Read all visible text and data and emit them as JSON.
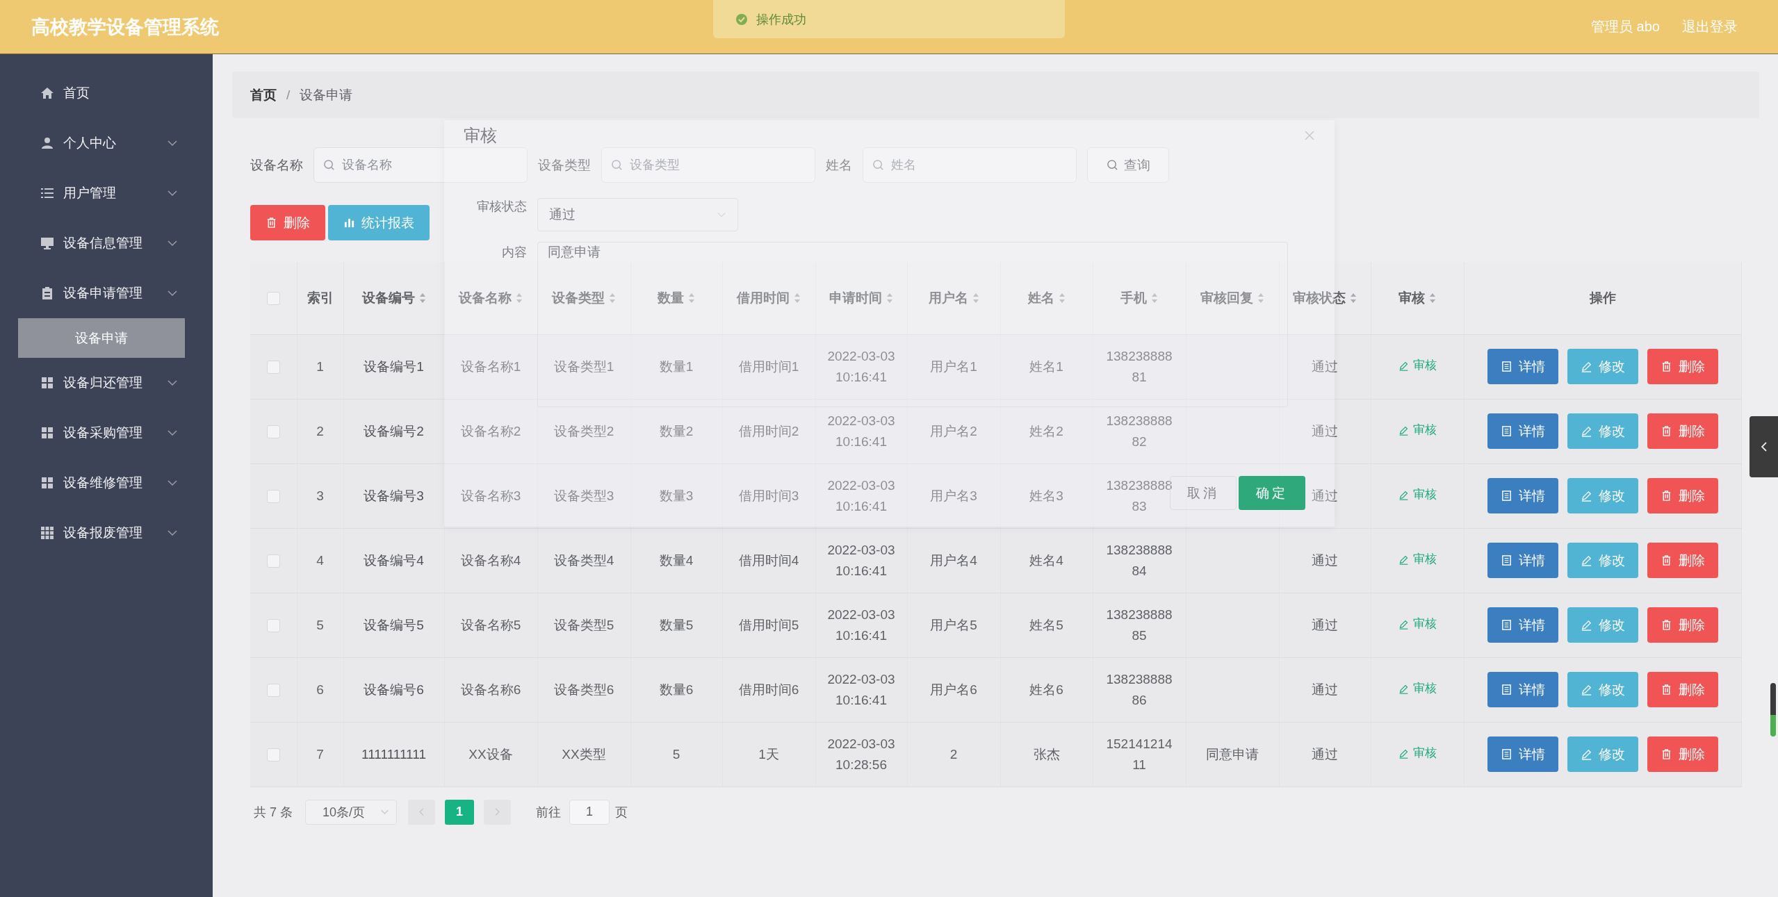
{
  "header": {
    "title": "高校教学设备管理系统",
    "user": "管理员 abo",
    "logout": "退出登录"
  },
  "toast": {
    "message": "操作成功"
  },
  "sidebar": {
    "items": [
      {
        "label": "首页",
        "kind": "link"
      },
      {
        "label": "个人中心",
        "kind": "submenu"
      },
      {
        "label": "用户管理",
        "kind": "submenu"
      },
      {
        "label": "设备信息管理",
        "kind": "submenu"
      },
      {
        "label": "设备申请管理",
        "kind": "submenu",
        "children": [
          {
            "label": "设备申请",
            "selected": true
          }
        ]
      },
      {
        "label": "设备归还管理",
        "kind": "submenu"
      },
      {
        "label": "设备采购管理",
        "kind": "submenu"
      },
      {
        "label": "设备维修管理",
        "kind": "submenu"
      },
      {
        "label": "设备报废管理",
        "kind": "submenu"
      }
    ]
  },
  "breadcrumb": {
    "items": [
      "首页",
      "设备申请"
    ],
    "separator": "/"
  },
  "search": {
    "fields": [
      {
        "label": "设备名称",
        "placeholder": "设备名称"
      },
      {
        "label": "设备类型",
        "placeholder": "设备类型"
      },
      {
        "label": "姓名",
        "placeholder": "姓名"
      }
    ],
    "button": "查询"
  },
  "toolbar": [
    {
      "label": "删除",
      "kind": "danger"
    },
    {
      "label": "统计报表",
      "kind": "info"
    }
  ],
  "table": {
    "select_all": {
      "checked": false
    },
    "columns": [
      {
        "label": "索引",
        "sortable": false
      },
      {
        "label": "设备编号",
        "sortable": true
      },
      {
        "label": "设备名称",
        "sortable": true
      },
      {
        "label": "设备类型",
        "sortable": true
      },
      {
        "label": "数量",
        "sortable": true
      },
      {
        "label": "借用时间",
        "sortable": true
      },
      {
        "label": "申请时间",
        "sortable": true
      },
      {
        "label": "用户名",
        "sortable": true
      },
      {
        "label": "姓名",
        "sortable": true
      },
      {
        "label": "手机",
        "sortable": true
      },
      {
        "label": "审核回复",
        "sortable": true
      },
      {
        "label": "审核状态",
        "sortable": true
      },
      {
        "label": "审核",
        "sortable": true
      },
      {
        "label": "操作",
        "sortable": false
      }
    ],
    "rows": [
      {
        "checked": false,
        "index": "1",
        "code": "设备编号1",
        "name": "设备名称1",
        "type": "设备类型1",
        "quantity": "数量1",
        "borrow_time": "借用时间1",
        "apply_time": "2022-03-03 10:16:41",
        "username": "用户名1",
        "real_name": "姓名1",
        "phone": "13823888881",
        "status": "通过",
        "review": "审核",
        "actions": [
          {
            "label": "详情",
            "kind": "primary"
          },
          {
            "label": "修改",
            "kind": "info"
          },
          {
            "label": "删除",
            "kind": "danger"
          }
        ]
      },
      {
        "checked": false,
        "index": "2",
        "code": "设备编号2",
        "name": "设备名称2",
        "type": "设备类型2",
        "quantity": "数量2",
        "borrow_time": "借用时间2",
        "apply_time": "2022-03-03 10:16:41",
        "username": "用户名2",
        "real_name": "姓名2",
        "phone": "13823888882",
        "status": "通过",
        "review": "审核",
        "actions": [
          {
            "label": "详情",
            "kind": "primary"
          },
          {
            "label": "修改",
            "kind": "info"
          },
          {
            "label": "删除",
            "kind": "danger"
          }
        ]
      },
      {
        "checked": false,
        "index": "3",
        "code": "设备编号3",
        "name": "设备名称3",
        "type": "设备类型3",
        "quantity": "数量3",
        "borrow_time": "借用时间3",
        "apply_time": "2022-03-03 10:16:41",
        "username": "用户名3",
        "real_name": "姓名3",
        "phone": "13823888883",
        "status": "通过",
        "review": "审核",
        "actions": [
          {
            "label": "详情",
            "kind": "primary"
          },
          {
            "label": "修改",
            "kind": "info"
          },
          {
            "label": "删除",
            "kind": "danger"
          }
        ]
      },
      {
        "checked": false,
        "index": "4",
        "code": "设备编号4",
        "name": "设备名称4",
        "type": "设备类型4",
        "quantity": "数量4",
        "borrow_time": "借用时间4",
        "apply_time": "2022-03-03 10:16:41",
        "username": "用户名4",
        "real_name": "姓名4",
        "phone": "13823888884",
        "status": "通过",
        "review": "审核",
        "actions": [
          {
            "label": "详情",
            "kind": "primary"
          },
          {
            "label": "修改",
            "kind": "info"
          },
          {
            "label": "删除",
            "kind": "danger"
          }
        ]
      },
      {
        "checked": false,
        "index": "5",
        "code": "设备编号5",
        "name": "设备名称5",
        "type": "设备类型5",
        "quantity": "数量5",
        "borrow_time": "借用时间5",
        "apply_time": "2022-03-03 10:16:41",
        "username": "用户名5",
        "real_name": "姓名5",
        "phone": "13823888885",
        "status": "通过",
        "review": "审核",
        "actions": [
          {
            "label": "详情",
            "kind": "primary"
          },
          {
            "label": "修改",
            "kind": "info"
          },
          {
            "label": "删除",
            "kind": "danger"
          }
        ]
      },
      {
        "checked": false,
        "index": "6",
        "code": "设备编号6",
        "name": "设备名称6",
        "type": "设备类型6",
        "quantity": "数量6",
        "borrow_time": "借用时间6",
        "apply_time": "2022-03-03 10:16:41",
        "username": "用户名6",
        "real_name": "姓名6",
        "phone": "13823888886",
        "status": "通过",
        "review": "审核",
        "actions": [
          {
            "label": "详情",
            "kind": "primary"
          },
          {
            "label": "修改",
            "kind": "info"
          },
          {
            "label": "删除",
            "kind": "danger"
          }
        ]
      },
      {
        "checked": false,
        "index": "7",
        "code": "1111111111",
        "name": "XX设备",
        "type": "XX类型",
        "quantity": "5",
        "borrow_time": "1天",
        "apply_time": "2022-03-03 10:28:56",
        "username": "2",
        "real_name": "张杰",
        "phone": "15214121411",
        "reply": "同意申请",
        "status": "通过",
        "review": "审核",
        "actions": [
          {
            "label": "详情",
            "kind": "primary"
          },
          {
            "label": "修改",
            "kind": "info"
          },
          {
            "label": "删除",
            "kind": "danger"
          }
        ]
      }
    ]
  },
  "pagination": {
    "total": "共 7 条",
    "page_size": "10条/页",
    "pages": [
      {
        "label": "1",
        "selected": true
      }
    ],
    "goto_label": "前往",
    "goto_value": "1",
    "goto_suffix": "页"
  },
  "dialog": {
    "title": "审核",
    "status_label": "审核状态",
    "status_value": "通过",
    "content_label": "内容",
    "content_value": "同意申请",
    "buttons": [
      {
        "label": "取消",
        "kind": "default"
      },
      {
        "label": "确定",
        "kind": "primary"
      }
    ]
  }
}
